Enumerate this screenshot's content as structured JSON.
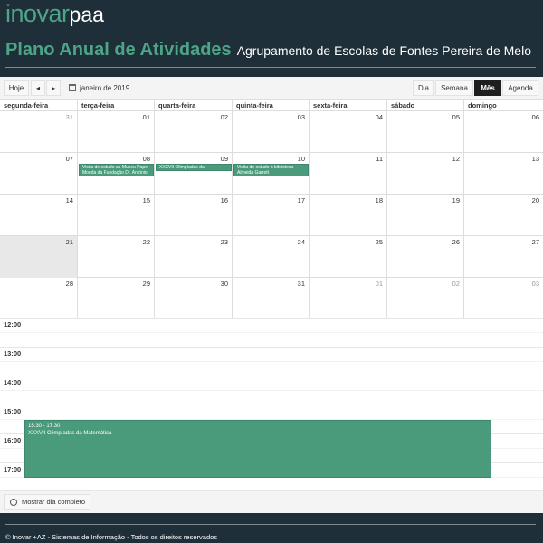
{
  "brand": {
    "part1": "inovar",
    "part2": "paa"
  },
  "header": {
    "title": "Plano Anual de Atividades",
    "subtitle": "Agrupamento de Escolas de Fontes Pereira de Melo"
  },
  "toolbar": {
    "today": "Hoje",
    "prev": "◂",
    "next": "▸",
    "current_month": "janeiro de 2019",
    "views": {
      "day": "Dia",
      "week": "Semana",
      "month": "Mês",
      "agenda": "Agenda"
    },
    "active_view": "Mês"
  },
  "weekdays": [
    "segunda-feira",
    "terça-feira",
    "quarta-feira",
    "quinta-feira",
    "sexta-feira",
    "sábado",
    "domingo"
  ],
  "weeks": [
    [
      "31",
      "01",
      "02",
      "03",
      "04",
      "05",
      "06"
    ],
    [
      "07",
      "08",
      "09",
      "10",
      "11",
      "12",
      "13"
    ],
    [
      "14",
      "15",
      "16",
      "17",
      "18",
      "19",
      "20"
    ],
    [
      "21",
      "22",
      "23",
      "24",
      "25",
      "26",
      "27"
    ],
    [
      "28",
      "29",
      "30",
      "31",
      "01",
      "02",
      "03"
    ]
  ],
  "events": [
    {
      "title": "Visita de estudo ao Museu Papel Moeda da Fundação Dr. António"
    },
    {
      "title": "XXXVII Olimpíadas da Matemática"
    },
    {
      "title": "Visita de estudo à biblioteca Almeida Garrett"
    }
  ],
  "time_slots": [
    "12:00",
    "13:00",
    "14:00",
    "15:00",
    "16:00",
    "17:00"
  ],
  "time_event": {
    "time": "15:30 - 17:30",
    "title": "XXXVII Olimpíadas da Matemática"
  },
  "show_full_day": "Mostrar dia completo",
  "footer": {
    "copyright": "© Inovar +AZ - Sistemas de Informação - Todos os direitos reservados"
  },
  "colors": {
    "accent": "#4da487",
    "event": "#4a9a7c",
    "background": "#1f2f3a"
  }
}
